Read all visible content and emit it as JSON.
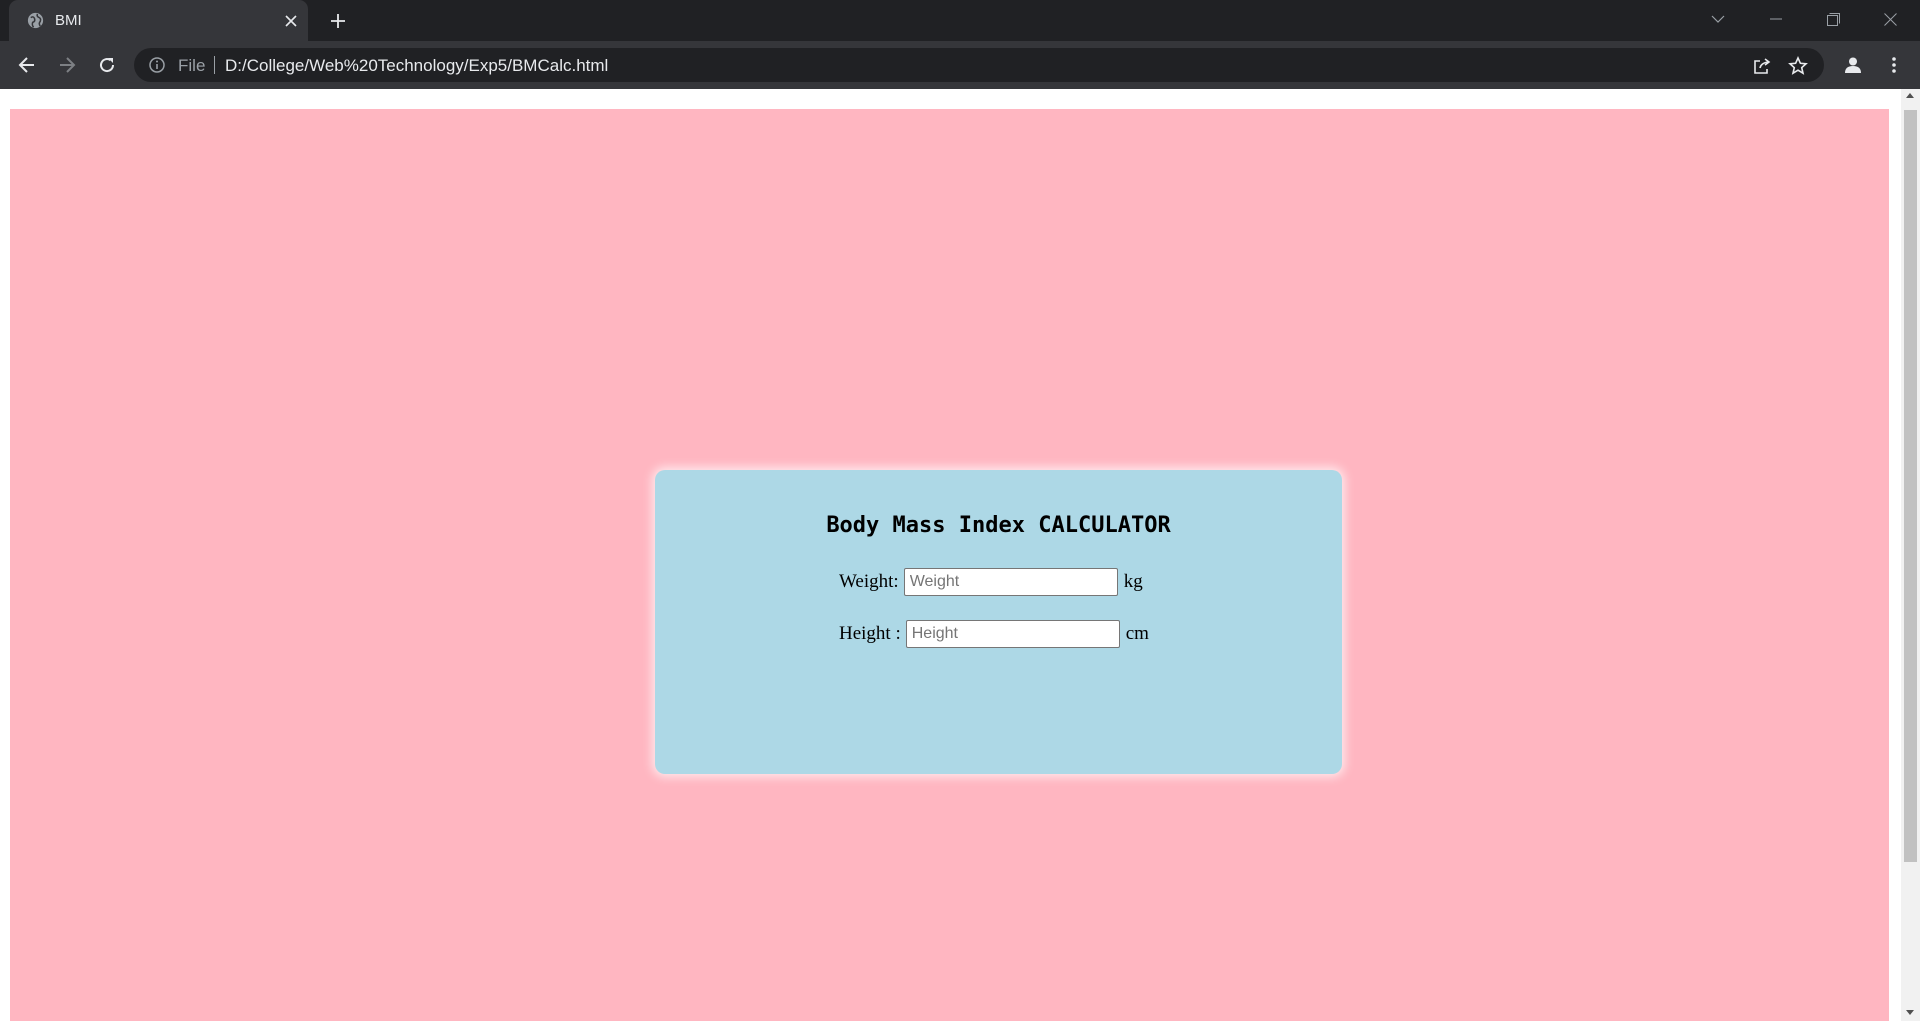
{
  "browser": {
    "tab": {
      "title": "BMI",
      "favicon": "globe-icon"
    },
    "omnibox": {
      "scheme_label": "File",
      "url": "D:/College/Web%20Technology/Exp5/BMCalc.html"
    },
    "icons": {
      "back": "arrow-left-icon",
      "forward": "arrow-right-icon",
      "reload": "reload-icon",
      "share": "share-icon",
      "bookmark": "star-icon",
      "profile": "person-icon",
      "menu": "kebab-menu-icon"
    },
    "colors": {
      "frame": "#202124",
      "toolbar": "#35363a",
      "text": "#e8eaed"
    }
  },
  "page": {
    "background_color": "#ffb6c1",
    "card": {
      "background_color": "#add8e6",
      "title": "Body Mass Index CALCULATOR",
      "weight": {
        "label": "Weight:",
        "placeholder": "Weight",
        "value": "",
        "unit": "kg"
      },
      "height": {
        "label": "Height :",
        "placeholder": "Height",
        "value": "",
        "unit": "cm"
      }
    }
  }
}
